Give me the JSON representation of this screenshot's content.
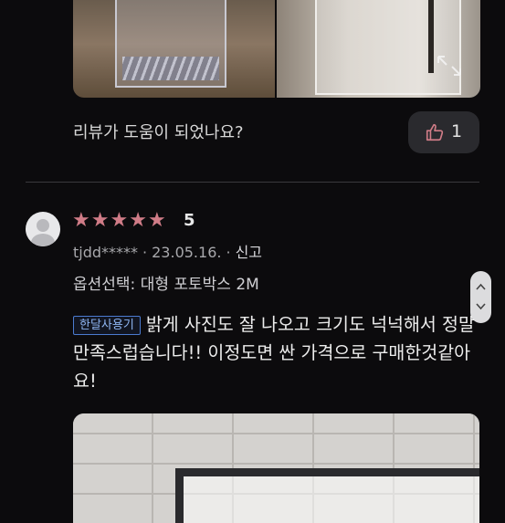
{
  "previous_review": {
    "helpful_question": "리뷰가 도움이 되었나요?",
    "like_count": "1"
  },
  "review": {
    "rating_value": 5,
    "rating_label": "5",
    "reviewer": "tjdd*****",
    "date": "23.05.16.",
    "meta_separator": "·",
    "report_label": "신고",
    "option_label": "옵션선택: 대형 포토박스 2M",
    "usage_badge": "한달사용기",
    "text": "밝게 사진도 잘 나오고 크기도 넉넉해서 정말 만족스럽습니다!! 이정도면 싼 가격으로 구매한것같아요!"
  },
  "icons": {
    "like": "thumbs-up-icon",
    "expand": "expand-icon",
    "avatar": "default-avatar-icon",
    "star": "star-icon",
    "scroll_up": "chevron-up-icon",
    "scroll_down": "chevron-down-icon"
  },
  "colors": {
    "background": "#0c0b0d",
    "star": "#d07c87",
    "badge_border": "#4b7bd0",
    "badge_text": "#8fb6f3",
    "like_button_bg": "#2a2a2e"
  }
}
